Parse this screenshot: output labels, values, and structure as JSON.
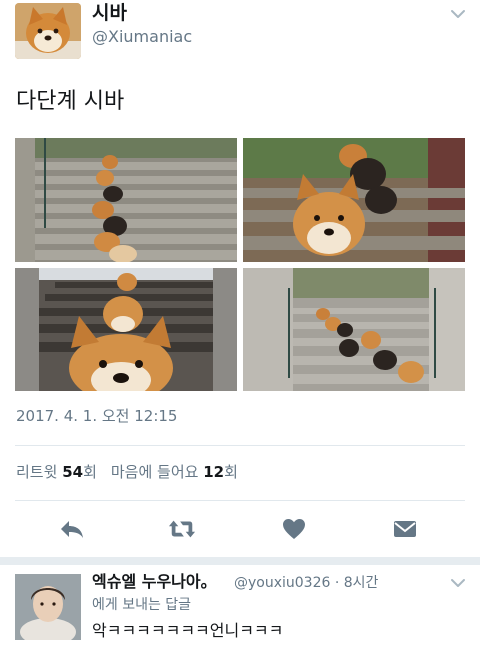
{
  "tweet": {
    "author_name": "시바",
    "author_handle": "@Xiumaniac",
    "text": "다단계 시바",
    "timestamp": "2017. 4. 1. 오전 12:15",
    "stats": {
      "retweets_label": "리트윗",
      "retweets_count": "54",
      "retweets_unit": "회",
      "likes_label": "마음에 들어요",
      "likes_count": "12",
      "likes_unit": "회"
    },
    "photos": [
      {
        "subject": "shiba-dogs-on-stairs"
      },
      {
        "subject": "shiba-dogs-stacked-on-stairs"
      },
      {
        "subject": "shiba-closeup-stairs"
      },
      {
        "subject": "shiba-dogs-row-on-stairs"
      }
    ],
    "actions": [
      {
        "name": "reply",
        "icon": "reply-icon"
      },
      {
        "name": "retweet",
        "icon": "retweet-icon"
      },
      {
        "name": "like",
        "icon": "heart-icon"
      },
      {
        "name": "direct-message",
        "icon": "envelope-icon"
      }
    ]
  },
  "reply": {
    "author_name": "엑슈엘 누우나아。",
    "author_handle": "@youxiu0326",
    "time": "· 8시간",
    "reply_to": "에게 보내는 답글",
    "text": "악ㅋㅋㅋㅋㅋㅋㅋ언니ㅋㅋㅋ"
  },
  "colors": {
    "text": "#14171a",
    "secondary": "#657786",
    "divider": "#e1e8ed",
    "icon": "#657786"
  }
}
